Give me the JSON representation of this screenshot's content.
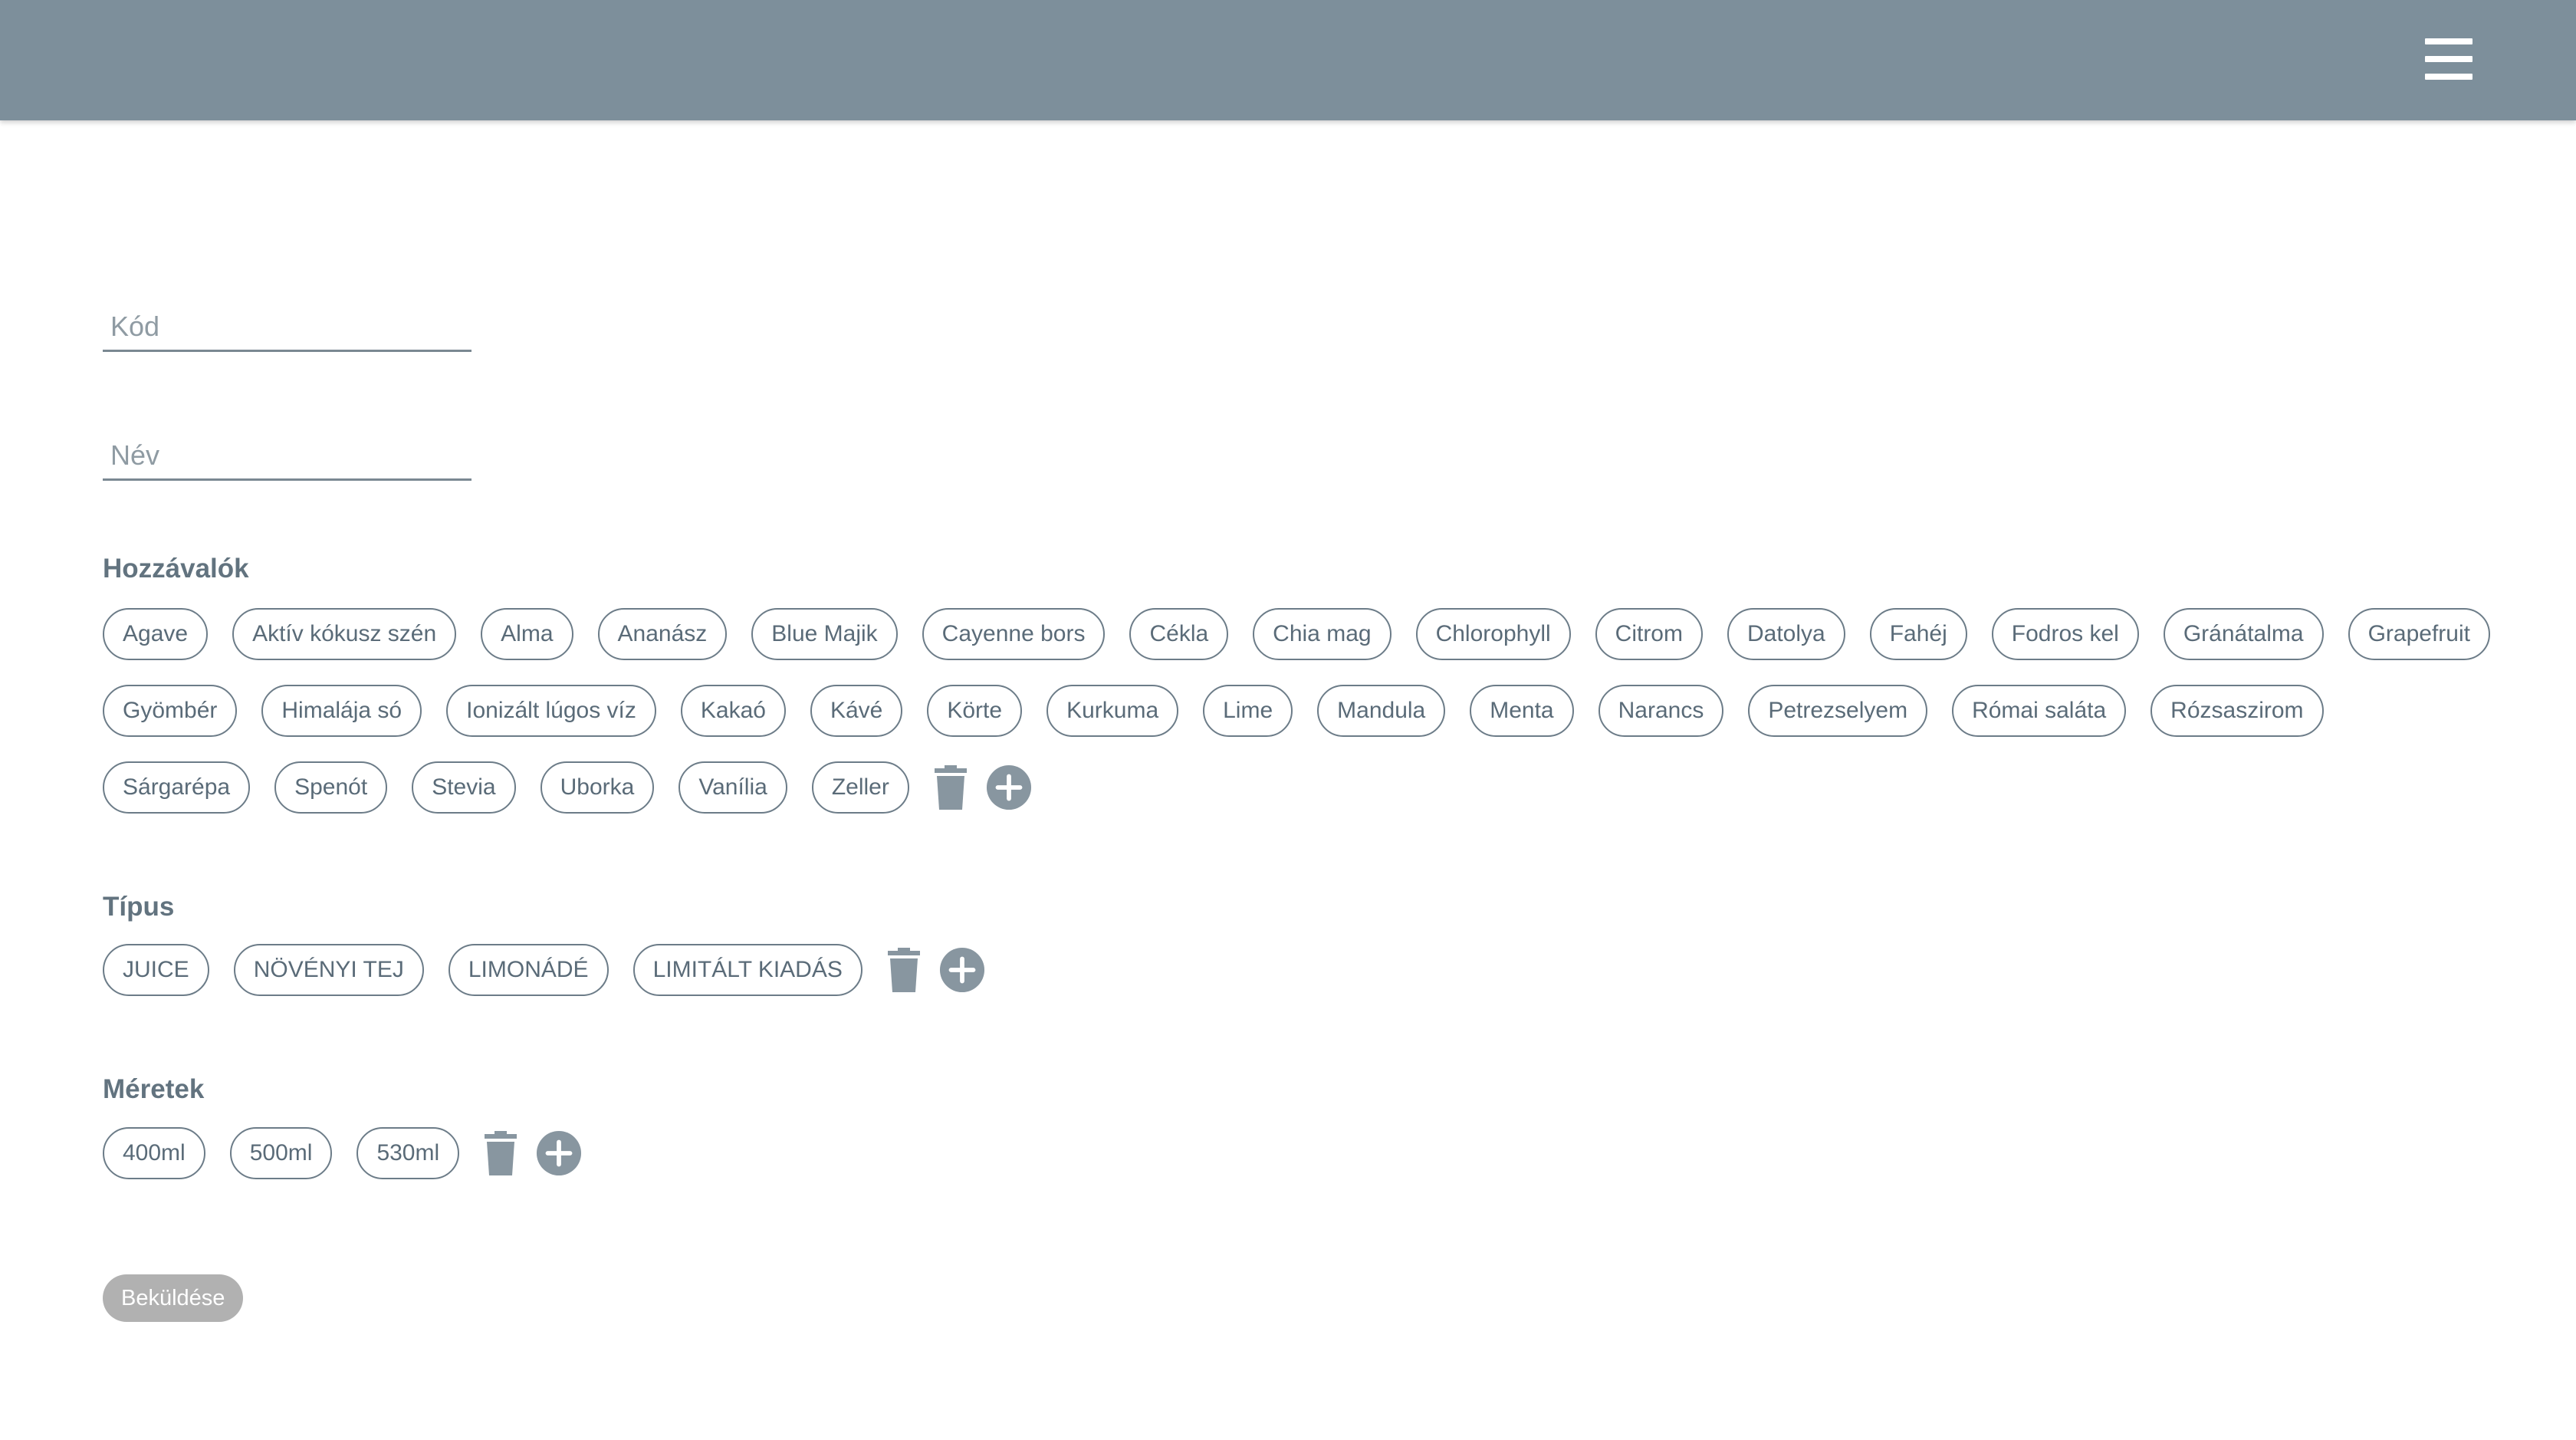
{
  "header": {
    "menu_icon": "hamburger-menu-icon"
  },
  "form": {
    "kod_placeholder": "Kód",
    "nev_placeholder": "Név",
    "submit_label": "Beküldése"
  },
  "ingredients": {
    "title": "Hozzávalók",
    "items": [
      "Agave",
      "Aktív kókusz szén",
      "Alma",
      "Ananász",
      "Blue Majik",
      "Cayenne bors",
      "Cékla",
      "Chia mag",
      "Chlorophyll",
      "Citrom",
      "Datolya",
      "Fahéj",
      "Fodros kel",
      "Gránátalma",
      "Grapefruit",
      "Gyömbér",
      "Himalája só",
      "Ionizált lúgos víz",
      "Kakaó",
      "Kávé",
      "Körte",
      "Kurkuma",
      "Lime",
      "Mandula",
      "Menta",
      "Narancs",
      "Petrezselyem",
      "Római saláta",
      "Rózsaszirom",
      "Sárgarépa",
      "Spenót",
      "Stevia",
      "Uborka",
      "Vanília",
      "Zeller"
    ]
  },
  "types": {
    "title": "Típus",
    "items": [
      "JUICE",
      "NÖVÉNYI TEJ",
      "LIMONÁDÉ",
      "LIMITÁLT KIADÁS"
    ]
  },
  "sizes": {
    "title": "Méretek",
    "items": [
      "400ml",
      "500ml",
      "530ml"
    ]
  },
  "icons": {
    "delete": "trash-icon",
    "add": "plus-circle-icon"
  },
  "colors": {
    "header_bg": "#7d8f9b",
    "icon": "#8896a0",
    "submit_bg": "#b1b1b1"
  }
}
